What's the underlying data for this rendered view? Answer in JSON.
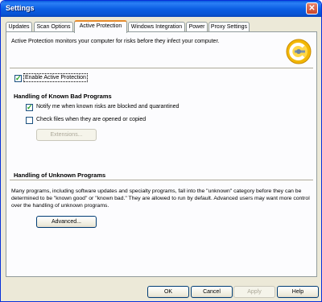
{
  "window": {
    "title": "Settings",
    "close_glyph": "✕"
  },
  "tabs": [
    {
      "label": "Updates"
    },
    {
      "label": "Scan Options"
    },
    {
      "label": "Active Protection",
      "active": true
    },
    {
      "label": "Windows Integration"
    },
    {
      "label": "Power"
    },
    {
      "label": "Proxy Settings"
    }
  ],
  "panel": {
    "intro": "Active Protection monitors your computer for risks before they infect your computer.",
    "logo_icon": "active-protection-logo",
    "enable": {
      "label": "Enable Active Protection",
      "checked": true
    },
    "known": {
      "title": "Handling of Known Bad Programs",
      "notify": {
        "label": "Notify me when known risks are blocked and quarantined",
        "checked": true
      },
      "check_files": {
        "label": "Check files when they are opened or copied",
        "checked": false
      },
      "extensions_label": "Extensions..."
    },
    "unknown": {
      "title": "Handling of Unknown Programs",
      "description": "Many programs, including software updates and specialty programs, fall into the \"unknown\" category before they can be determined to be \"known good\" or \"known bad.\" They are allowed to run by default. Advanced users may want more control over the handling of unknown programs.",
      "advanced_label": "Advanced..."
    }
  },
  "footer": {
    "ok": "OK",
    "cancel": "Cancel",
    "apply": "Apply",
    "help": "Help"
  },
  "colors": {
    "titlebar": "#0a5bde",
    "accent_tab": "#e68b2c",
    "face": "#ece9d8"
  }
}
